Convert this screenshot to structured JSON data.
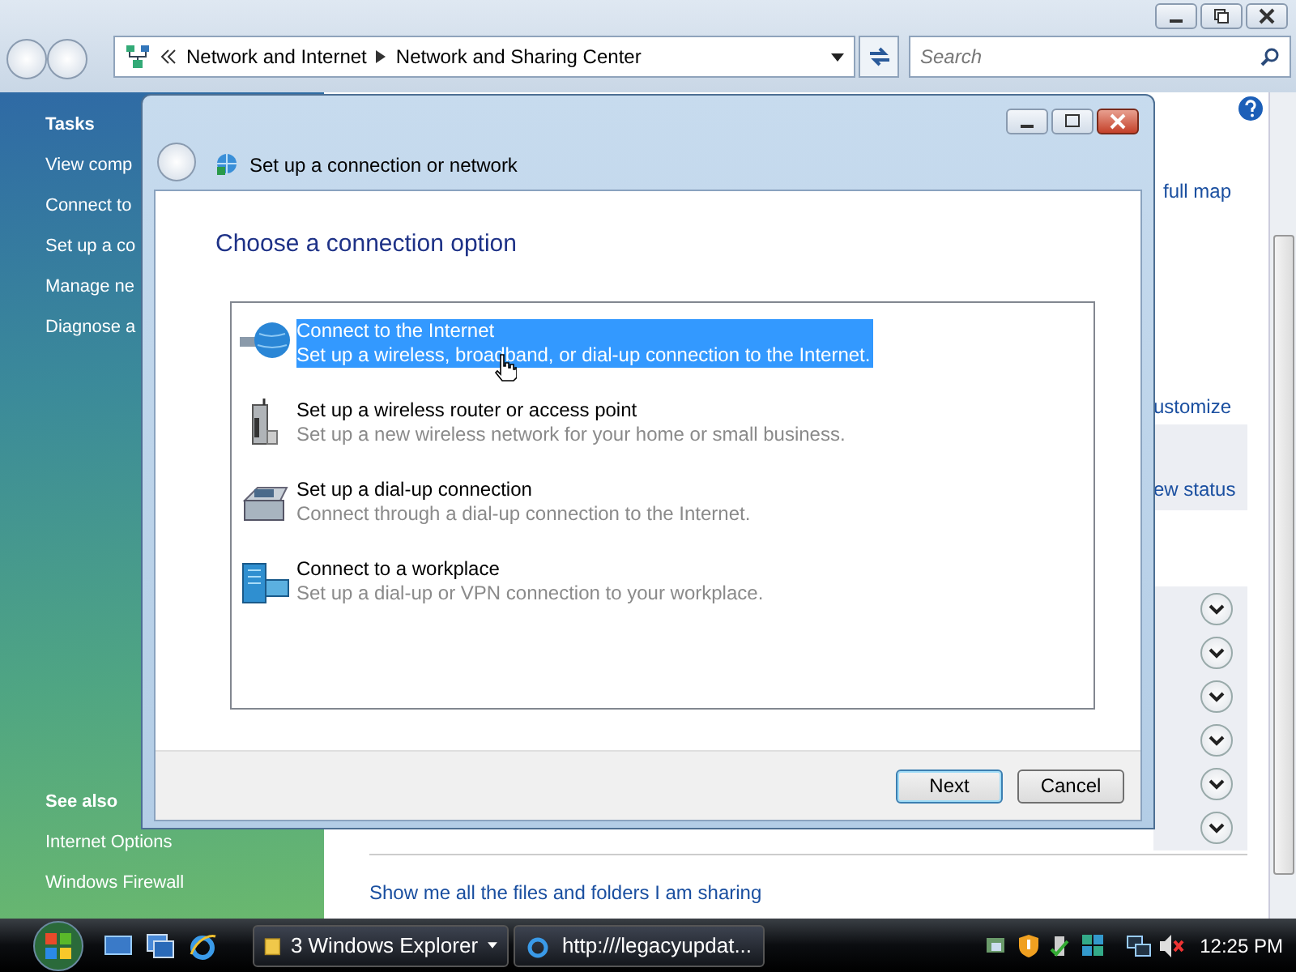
{
  "explorer": {
    "address": {
      "path": [
        "Network and Internet",
        "Network and Sharing Center"
      ]
    },
    "search": {
      "placeholder": "Search"
    },
    "sidebar": {
      "tasks_title": "Tasks",
      "tasks": [
        "View comp",
        "Connect to",
        "Set up a co",
        "Manage ne",
        "Diagnose a"
      ],
      "see_also_title": "See also",
      "see_also": [
        "Internet Options",
        "Windows Firewall"
      ]
    },
    "main": {
      "links": [
        "full map",
        "ustomize"
      ],
      "status_link": "ew status",
      "share_link": "Show me all the files and folders I am sharing"
    }
  },
  "dialog": {
    "title": "Set up a connection or network",
    "heading": "Choose a connection option",
    "options": [
      {
        "kind": "globe",
        "title": "Connect to the Internet",
        "description": "Set up a wireless, broadband, or dial-up connection to the Internet.",
        "selected": true
      },
      {
        "kind": "router",
        "title": "Set up a wireless router or access point",
        "description": "Set up a new wireless network for your home or small business.",
        "selected": false
      },
      {
        "kind": "phone",
        "title": "Set up a dial-up connection",
        "description": "Connect through a dial-up connection to the Internet.",
        "selected": false
      },
      {
        "kind": "workplace",
        "title": "Connect to a workplace",
        "description": "Set up a dial-up or VPN connection to your workplace.",
        "selected": false
      }
    ],
    "buttons": [
      "Next",
      "Cancel"
    ]
  },
  "taskbar": {
    "tasks": [
      "3 Windows Explorer",
      "http:///legacyupdat..."
    ],
    "clock": "12:25 PM"
  }
}
